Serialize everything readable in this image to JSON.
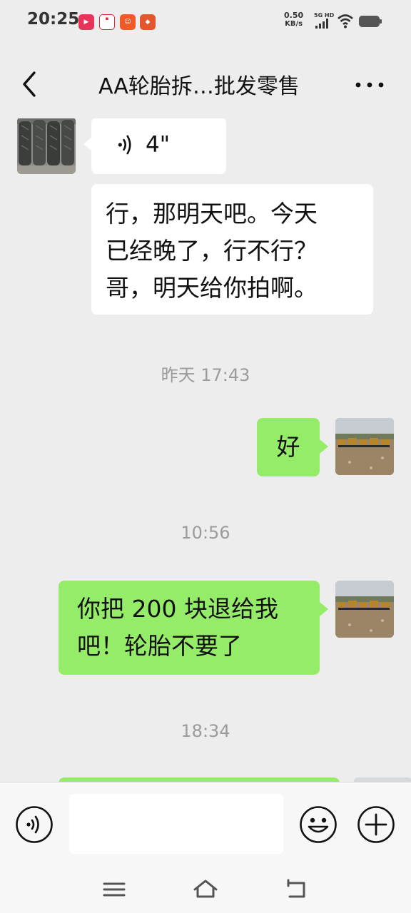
{
  "status_bar": {
    "time": "20:25",
    "net_speed_value": "0.50",
    "net_speed_unit": "KB/s",
    "network_label": "5G HD",
    "app_icons": [
      "video-app-icon",
      "news-app-icon",
      "shopping-app-icon",
      "game-app-icon"
    ]
  },
  "header": {
    "title": "AA轮胎拆…批发零售",
    "back_icon": "chevron-left-icon",
    "more_icon": "more-horizontal-icon"
  },
  "messages": {
    "voice": {
      "duration": "4\"",
      "icon": "voice-wave-icon"
    },
    "text_received": {
      "lines": [
        "行，那明天吧。今天",
        "已经晚了，行不行？",
        "哥，明天给你拍啊。"
      ]
    },
    "time1": "昨天 17:43",
    "sent1": {
      "text": "好"
    },
    "time2": "10:56",
    "sent2": {
      "lines": [
        "你把 200 块退给我",
        "吧！轮胎不要了"
      ]
    },
    "time3": "18:34"
  },
  "input_bar": {
    "voice_icon": "voice-input-icon",
    "emoji_icon": "emoji-icon",
    "plus_icon": "plus-icon",
    "input_value": ""
  },
  "nav_bar": {
    "menu_icon": "menu-icon",
    "home_icon": "home-icon",
    "back_icon": "return-icon"
  },
  "colors": {
    "background": "#ededed",
    "sent_bubble": "#95ec69",
    "received_bubble": "#ffffff",
    "timestamp": "#9b9b9b"
  }
}
